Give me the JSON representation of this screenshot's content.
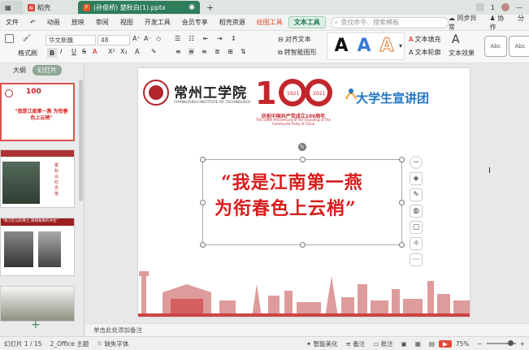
{
  "titlebar": {
    "tab_daoke": "稻壳",
    "doc_tab": "(孙俊桥) 楚秋白(1).pptx",
    "doc_badge": "P",
    "page_indicator": "1"
  },
  "menubar": {
    "file": "文件",
    "items": [
      "动画",
      "放映",
      "审阅",
      "视图",
      "开发工具",
      "会员专享",
      "稻壳资源"
    ],
    "drawing_tools": "绘图工具",
    "text_tools": "文本工具",
    "search_placeholder": "查找命令、搜索模板",
    "sync": "同步异常",
    "collab": "协作",
    "share": "分"
  },
  "toolbar": {
    "brush_label": "格式刷",
    "font_name": "华文新魏",
    "font_size": "48",
    "align_text": "对齐文本",
    "convert_smartart": "转智能图形",
    "text_fill": "文本填充",
    "text_outline": "文本轮廓",
    "text_effect": "文本效果",
    "abc1": "Abc",
    "abc2": "Abc"
  },
  "leftpanel": {
    "tab_outline": "大纲",
    "tab_slides": "幻灯片",
    "slide_numbers": [
      "1",
      "2",
      "3",
      "4"
    ],
    "thumb1_title": "\"我是江南第一燕 为衔春色上云梢\"",
    "thumb3_title": "\"铁刀在与的骨士,铮铮铁骨的书生\"",
    "thumb2_title": "瞿秋白纪念馆"
  },
  "slide": {
    "school_name": "常州工学院",
    "school_en": "CHANGZHOU INSTITUTE OF TECHNOLOGY",
    "party_cn": "庆祝中国共产党成立100周年",
    "party_en": "The 100th Anniversary of the Founding of The Communist Party of China",
    "year_left": "1921",
    "year_right": "2021",
    "team_name": "大学生宣讲团",
    "title_line1": "“我是江南第一燕",
    "title_line2": "为衔春色上云梢”"
  },
  "notes_placeholder": "单击此处添加备注",
  "statusbar": {
    "slide_count": "幻灯片 1 / 15",
    "theme": "2_Office 主题",
    "missing_font": "缺失字体",
    "smart_beautify": "智能美化",
    "notes": "备注",
    "comments": "批注",
    "zoom": "75%"
  },
  "colors": {
    "accent_green": "#2e7d5b",
    "title_red": "#d71d1d",
    "party_red": "#c1272d",
    "team_blue": "#1f74c2"
  }
}
